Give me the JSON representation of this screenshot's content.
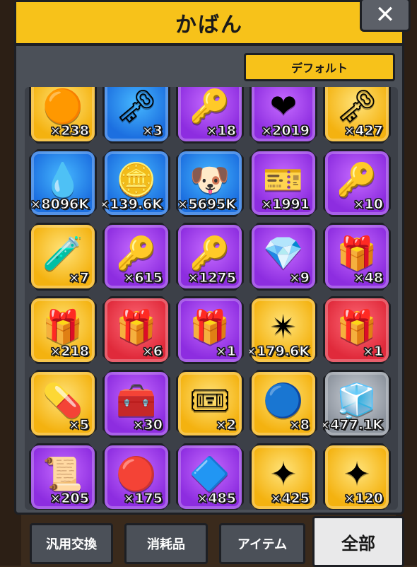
{
  "header": {
    "title": "かばん",
    "close_label": "✕"
  },
  "preset": {
    "label": "デフォルト"
  },
  "items": [
    {
      "icon": "orange-coin-icon",
      "glyph": "🟠",
      "rarity": "gold",
      "qty": "×238"
    },
    {
      "icon": "silver-key-icon",
      "glyph": "🗝",
      "rarity": "blue",
      "qty": "×3"
    },
    {
      "icon": "gold-key-icon",
      "glyph": "🔑",
      "rarity": "purple",
      "qty": "×18"
    },
    {
      "icon": "heart-medal-icon",
      "glyph": "❤",
      "rarity": "purple",
      "qty": "×2019"
    },
    {
      "icon": "gem-key-icon",
      "glyph": "🗝",
      "rarity": "gold",
      "qty": "×427"
    },
    {
      "icon": "energy-drop-icon",
      "glyph": "💧",
      "rarity": "blue",
      "qty": "×8096K"
    },
    {
      "icon": "gold-coin-icon",
      "glyph": "🪙",
      "rarity": "blue",
      "qty": "×139.6K"
    },
    {
      "icon": "dog-cookie-icon",
      "glyph": "🐶",
      "rarity": "blue",
      "qty": "×5695K"
    },
    {
      "icon": "gold-ticket-icon",
      "glyph": "🎫",
      "rarity": "purple",
      "qty": "×1991"
    },
    {
      "icon": "bear-key-icon",
      "glyph": "🔑",
      "rarity": "purple",
      "qty": "×10"
    },
    {
      "icon": "potion-icon",
      "glyph": "🧪",
      "rarity": "gold",
      "qty": "×7"
    },
    {
      "icon": "purple-gem-key-icon",
      "glyph": "🔑",
      "rarity": "purple",
      "qty": "×615"
    },
    {
      "icon": "hexagon-key-icon",
      "glyph": "🔑",
      "rarity": "purple",
      "qty": "×1275"
    },
    {
      "icon": "diamond-card-icon",
      "glyph": "💎",
      "rarity": "purple",
      "qty": "×9"
    },
    {
      "icon": "pink-gift-icon",
      "glyph": "🎁",
      "rarity": "purple",
      "qty": "×48"
    },
    {
      "icon": "orange-gift-icon",
      "glyph": "🎁",
      "rarity": "gold",
      "qty": "×218"
    },
    {
      "icon": "red-gift-icon",
      "glyph": "🎁",
      "rarity": "red",
      "qty": "×6"
    },
    {
      "icon": "small-gift-icon",
      "glyph": "🎁",
      "rarity": "purple",
      "qty": "×1"
    },
    {
      "icon": "star-crystal-icon",
      "glyph": "✴",
      "rarity": "gold",
      "qty": "×179.6K"
    },
    {
      "icon": "red-gift-plus-icon",
      "glyph": "🎁",
      "rarity": "red",
      "qty": "×1"
    },
    {
      "icon": "capsule-icon",
      "glyph": "💊",
      "rarity": "gold",
      "qty": "×5"
    },
    {
      "icon": "chest-icon",
      "glyph": "🧰",
      "rarity": "purple",
      "qty": "×30"
    },
    {
      "icon": "v-ticket-icon",
      "glyph": "🎟",
      "rarity": "gold",
      "qty": "×2"
    },
    {
      "icon": "v-coin-icon",
      "glyph": "🔵",
      "rarity": "gold",
      "qty": "×8"
    },
    {
      "icon": "cube-icon",
      "glyph": "🧊",
      "rarity": "gray",
      "qty": "×477.1K"
    },
    {
      "icon": "scroll-icon",
      "glyph": "📜",
      "rarity": "purple",
      "qty": "×205"
    },
    {
      "icon": "red-gem-icon",
      "glyph": "🔴",
      "rarity": "purple",
      "qty": "×175"
    },
    {
      "icon": "purple-crystal-icon",
      "glyph": "🔷",
      "rarity": "purple",
      "qty": "×485"
    },
    {
      "icon": "gold-star-icon",
      "glyph": "✦",
      "rarity": "gold",
      "qty": "×425"
    },
    {
      "icon": "blue-star-icon",
      "glyph": "✦",
      "rarity": "gold",
      "qty": "×120"
    }
  ],
  "tabs": [
    {
      "label": "汎用交換",
      "active": false
    },
    {
      "label": "消耗品",
      "active": false
    },
    {
      "label": "アイテム",
      "active": false
    },
    {
      "label": "全部",
      "active": true
    }
  ]
}
